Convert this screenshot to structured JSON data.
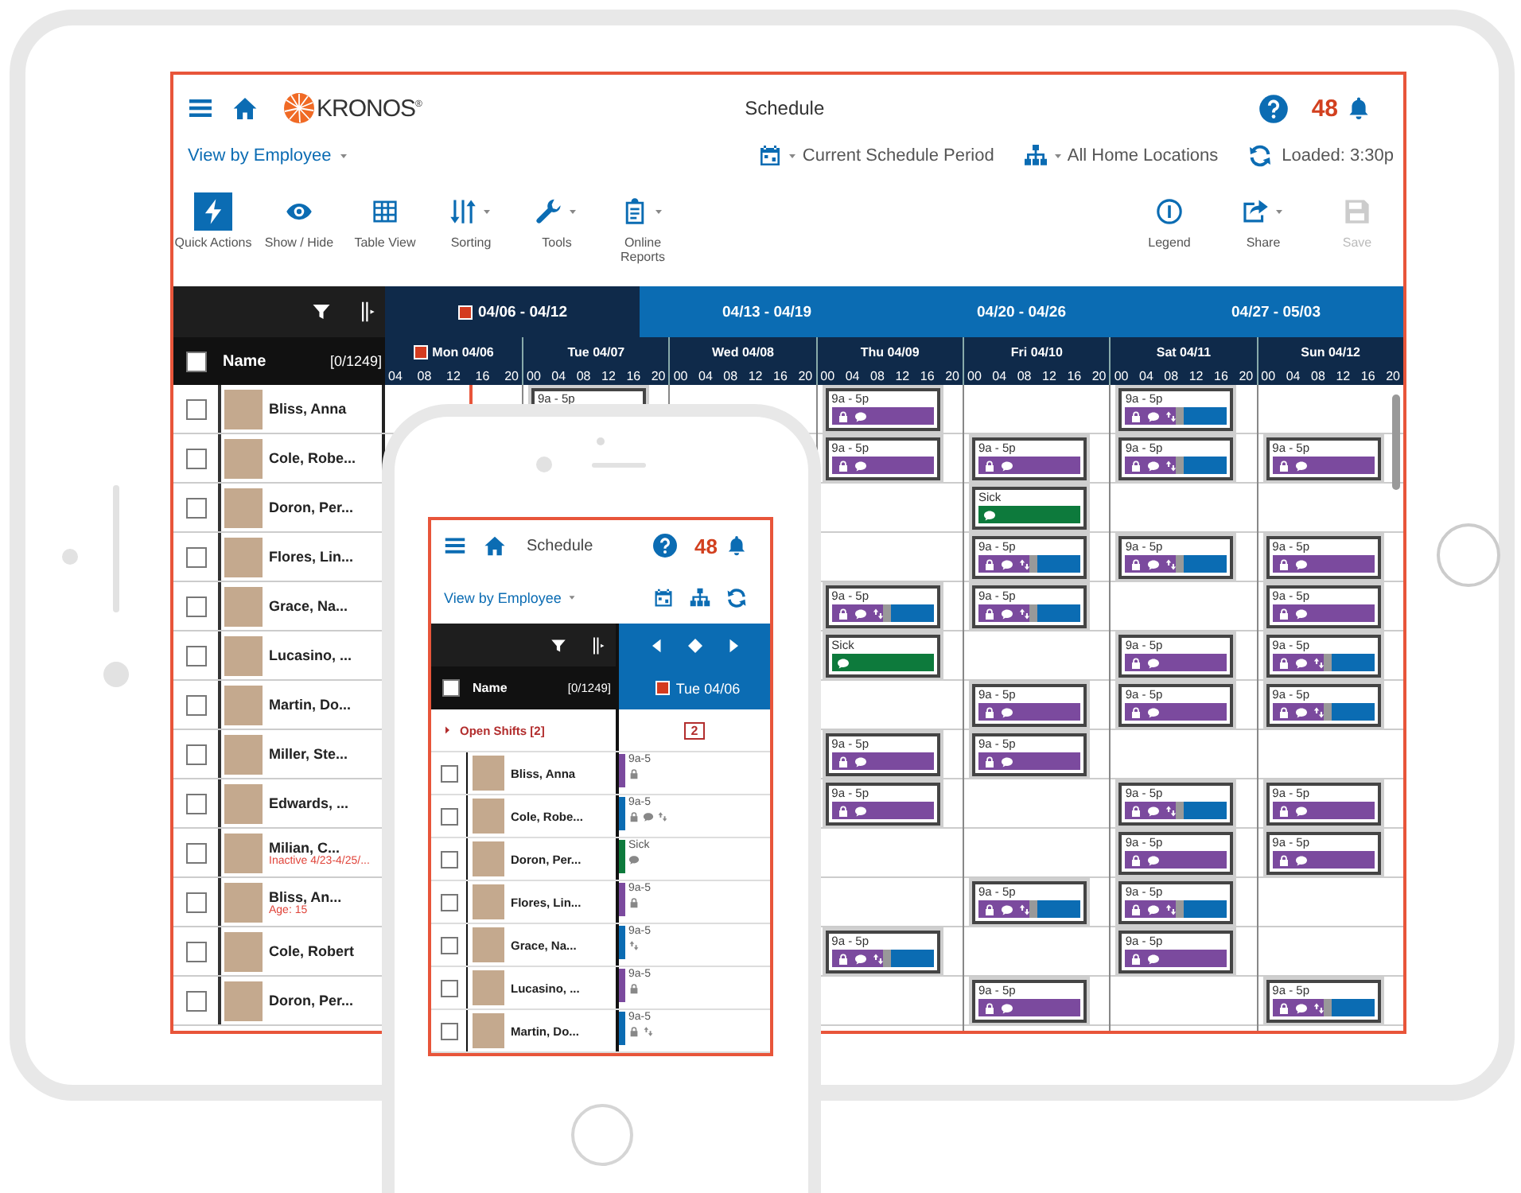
{
  "tablet": {
    "header": {
      "logo_text": "KRONOS$^{®}$",
      "title": "Schedule",
      "notification_count": "48"
    },
    "view_selector": {
      "label": "View by Employee"
    },
    "filters": [
      {
        "kind": "calendar",
        "label": "Current Schedule Period"
      },
      {
        "kind": "locations",
        "label": "All Home Locations"
      }
    ],
    "loaded": "Loaded: 3:30p",
    "toolbar_left": [
      {
        "kind": "quick",
        "label": "Quick Actions",
        "selected": true,
        "menu": false,
        "disabled": false
      },
      {
        "kind": "show",
        "label": "Show / Hide",
        "selected": false,
        "menu": false,
        "disabled": false
      },
      {
        "kind": "table",
        "label": "Table View",
        "selected": false,
        "menu": false,
        "disabled": false
      },
      {
        "kind": "sorting",
        "label": "Sorting",
        "selected": false,
        "menu": true,
        "disabled": false
      },
      {
        "kind": "tools",
        "label": "Tools",
        "selected": false,
        "menu": true,
        "disabled": false
      },
      {
        "kind": "reports",
        "label": "Online Reports",
        "selected": false,
        "menu": true,
        "disabled": false
      }
    ],
    "toolbar_right": [
      {
        "kind": "legend",
        "label": "Legend",
        "selected": false,
        "menu": false,
        "disabled": false
      },
      {
        "kind": "share",
        "label": "Share",
        "selected": false,
        "menu": true,
        "disabled": false
      },
      {
        "kind": "save",
        "label": "Save",
        "selected": false,
        "menu": false,
        "disabled": true
      }
    ],
    "name_header": {
      "label": "Name",
      "count": "[0/1249]",
      "checked": false
    },
    "weeks": [
      {
        "label": "04/06 - 04/12",
        "selected": true
      },
      {
        "label": "04/13 - 04/19",
        "selected": false
      },
      {
        "label": "04/20 - 04/26",
        "selected": false
      },
      {
        "label": "04/27 - 05/03",
        "selected": false
      }
    ],
    "days": [
      {
        "label": "Mon 04/06",
        "today": true,
        "hours": [
          "04",
          "08",
          "12",
          "16",
          "20"
        ]
      },
      {
        "label": "Tue 04/07",
        "today": false,
        "hours": [
          "00",
          "04",
          "08",
          "12",
          "16",
          "20"
        ]
      },
      {
        "label": "Wed 04/08",
        "today": false,
        "hours": [
          "00",
          "04",
          "08",
          "12",
          "16",
          "20"
        ]
      },
      {
        "label": "Thu 04/09",
        "today": false,
        "hours": [
          "00",
          "04",
          "08",
          "12",
          "16",
          "20"
        ]
      },
      {
        "label": "Fri 04/10",
        "today": false,
        "hours": [
          "00",
          "04",
          "08",
          "12",
          "16",
          "20"
        ]
      },
      {
        "label": "Sat 04/11",
        "today": false,
        "hours": [
          "00",
          "04",
          "08",
          "12",
          "16",
          "20"
        ]
      },
      {
        "label": "Sun 04/12",
        "today": false,
        "hours": [
          "00",
          "04",
          "08",
          "12",
          "16",
          "20"
        ]
      }
    ],
    "rows": [
      {
        "name": "Bliss, Anna",
        "checked": false,
        "week": [
          {
            "kind": "empty"
          },
          {
            "kind": "cut",
            "label": "9a - 5p"
          },
          {
            "kind": "empty"
          },
          {
            "kind": "shift",
            "label": "9a - 5p"
          },
          {
            "kind": "empty"
          },
          {
            "kind": "transfer",
            "label": "9a - 5p"
          },
          {
            "kind": "empty"
          }
        ]
      },
      {
        "name": "Cole, Robe...",
        "checked": false,
        "week": [
          {
            "kind": "empty"
          },
          {
            "kind": "empty"
          },
          {
            "kind": "empty"
          },
          {
            "kind": "shift",
            "label": "9a - 5p"
          },
          {
            "kind": "shift",
            "label": "9a - 5p"
          },
          {
            "kind": "transfer",
            "label": "9a - 5p"
          },
          {
            "kind": "shift",
            "label": "9a - 5p"
          }
        ]
      },
      {
        "name": "Doron, Per...",
        "checked": false,
        "week": [
          {
            "kind": "empty"
          },
          {
            "kind": "empty"
          },
          {
            "kind": "empty"
          },
          {
            "kind": "empty"
          },
          {
            "kind": "sick",
            "label": "Sick"
          },
          {
            "kind": "empty"
          },
          {
            "kind": "empty"
          }
        ]
      },
      {
        "name": "Flores, Lin...",
        "checked": false,
        "week": [
          {
            "kind": "empty"
          },
          {
            "kind": "empty"
          },
          {
            "kind": "empty"
          },
          {
            "kind": "empty"
          },
          {
            "kind": "transfer",
            "label": "9a - 5p"
          },
          {
            "kind": "transfer",
            "label": "9a - 5p"
          },
          {
            "kind": "shift",
            "label": "9a - 5p"
          }
        ]
      },
      {
        "name": "Grace, Na...",
        "checked": false,
        "week": [
          {
            "kind": "empty"
          },
          {
            "kind": "empty"
          },
          {
            "kind": "empty"
          },
          {
            "kind": "transfer",
            "label": "9a - 5p"
          },
          {
            "kind": "transfer",
            "label": "9a - 5p"
          },
          {
            "kind": "empty"
          },
          {
            "kind": "shift",
            "label": "9a - 5p"
          }
        ]
      },
      {
        "name": "Lucasino, ...",
        "checked": false,
        "week": [
          {
            "kind": "empty"
          },
          {
            "kind": "empty"
          },
          {
            "kind": "empty"
          },
          {
            "kind": "sick",
            "label": "Sick"
          },
          {
            "kind": "empty"
          },
          {
            "kind": "shift",
            "label": "9a - 5p"
          },
          {
            "kind": "transfer",
            "label": "9a - 5p"
          }
        ]
      },
      {
        "name": "Martin, Do...",
        "checked": false,
        "week": [
          {
            "kind": "empty"
          },
          {
            "kind": "empty"
          },
          {
            "kind": "empty"
          },
          {
            "kind": "empty"
          },
          {
            "kind": "shift",
            "label": "9a - 5p"
          },
          {
            "kind": "shift",
            "label": "9a - 5p"
          },
          {
            "kind": "transfer",
            "label": "9a - 5p"
          }
        ]
      },
      {
        "name": "Miller, Ste...",
        "checked": false,
        "week": [
          {
            "kind": "empty"
          },
          {
            "kind": "empty"
          },
          {
            "kind": "empty"
          },
          {
            "kind": "shift",
            "label": "9a - 5p"
          },
          {
            "kind": "shift",
            "label": "9a - 5p"
          },
          {
            "kind": "empty"
          },
          {
            "kind": "empty"
          }
        ]
      },
      {
        "name": "Edwards, ...",
        "checked": false,
        "week": [
          {
            "kind": "empty"
          },
          {
            "kind": "empty"
          },
          {
            "kind": "empty"
          },
          {
            "kind": "shift",
            "label": "9a - 5p"
          },
          {
            "kind": "empty"
          },
          {
            "kind": "transfer",
            "label": "9a - 5p"
          },
          {
            "kind": "shift",
            "label": "9a - 5p"
          }
        ]
      },
      {
        "name": "Milian, C...",
        "note": "Inactive 4/23-4/25/...",
        "checked": false,
        "week": [
          {
            "kind": "empty"
          },
          {
            "kind": "empty"
          },
          {
            "kind": "empty"
          },
          {
            "kind": "empty"
          },
          {
            "kind": "empty"
          },
          {
            "kind": "shift",
            "label": "9a - 5p"
          },
          {
            "kind": "shift",
            "label": "9a - 5p"
          }
        ]
      },
      {
        "name": "Bliss, An...",
        "note": "Age: 15",
        "checked": false,
        "week": [
          {
            "kind": "empty"
          },
          {
            "kind": "empty"
          },
          {
            "kind": "empty"
          },
          {
            "kind": "empty"
          },
          {
            "kind": "transfer",
            "label": "9a - 5p"
          },
          {
            "kind": "transfer",
            "label": "9a - 5p"
          },
          {
            "kind": "empty"
          }
        ]
      },
      {
        "name": "Cole, Robert",
        "checked": false,
        "week": [
          {
            "kind": "empty"
          },
          {
            "kind": "empty"
          },
          {
            "kind": "empty"
          },
          {
            "kind": "transfer",
            "label": "9a - 5p"
          },
          {
            "kind": "empty"
          },
          {
            "kind": "shift",
            "label": "9a - 5p"
          },
          {
            "kind": "empty"
          }
        ]
      },
      {
        "name": "Doron, Per...",
        "checked": false,
        "week": [
          {
            "kind": "empty"
          },
          {
            "kind": "empty"
          },
          {
            "kind": "empty"
          },
          {
            "kind": "empty"
          },
          {
            "kind": "shift",
            "label": "9a - 5p"
          },
          {
            "kind": "empty"
          },
          {
            "kind": "transfer",
            "label": "9a - 5p"
          }
        ]
      }
    ]
  },
  "phone": {
    "header": {
      "title": "Schedule",
      "notification_count": "48"
    },
    "view_selector": {
      "label": "View by Employee"
    },
    "name_header": {
      "label": "Name",
      "count": "[0/1249]",
      "checked": false
    },
    "day": {
      "label": "Tue 04/06",
      "today": true
    },
    "open_shifts": {
      "label": "Open Shifts [2]",
      "count": "2",
      "expanded": false
    },
    "rows": [
      {
        "name": "Bliss, Anna",
        "checked": false,
        "shift": {
          "label": "9a-5",
          "color": "#7b4a9e",
          "locked": true,
          "comment": false,
          "swap": false
        }
      },
      {
        "name": "Cole, Robe...",
        "checked": false,
        "shift": {
          "label": "9a-5",
          "color": "#0b6cb3",
          "locked": true,
          "comment": true,
          "swap": true
        }
      },
      {
        "name": "Doron, Per...",
        "checked": false,
        "shift": {
          "label": "Sick",
          "color": "#0d7a3c",
          "locked": false,
          "comment": true,
          "swap": false
        }
      },
      {
        "name": "Flores, Lin...",
        "checked": false,
        "shift": {
          "label": "9a-5",
          "color": "#7b4a9e",
          "locked": true,
          "comment": false,
          "swap": false
        }
      },
      {
        "name": "Grace, Na...",
        "checked": false,
        "shift": {
          "label": "9a-5",
          "color": "#0b6cb3",
          "locked": false,
          "comment": false,
          "swap": true
        }
      },
      {
        "name": "Lucasino, ...",
        "checked": false,
        "shift": {
          "label": "9a-5",
          "color": "#7b4a9e",
          "locked": true,
          "comment": false,
          "swap": false
        }
      },
      {
        "name": "Martin, Do...",
        "checked": false,
        "shift": {
          "label": "9a-5",
          "color": "#0b6cb3",
          "locked": true,
          "comment": false,
          "swap": true
        }
      }
    ]
  }
}
